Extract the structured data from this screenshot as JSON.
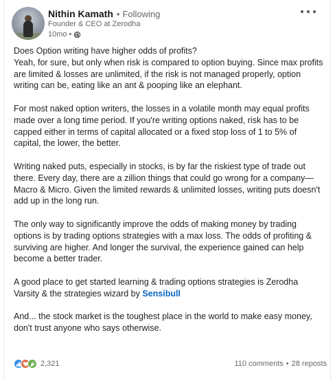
{
  "author": {
    "name": "Nithin Kamath",
    "follow_separator": "•",
    "follow_status": "Following",
    "headline": "Founder & CEO at Zerodha",
    "time": "10mo",
    "time_separator": "•"
  },
  "post": {
    "paragraphs": [
      "Does Option writing have higher odds of profits?\nYeah, for sure, but only when risk is compared to option buying. Since max profits\nare limited & losses are unlimited, if the risk is not managed properly, option\nwriting can be, eating like an ant & pooping like an elephant.",
      "For most naked option writers, the losses in a volatile month may equal profits\nmade over a long time period. If you're writing options naked, risk has to be\ncapped either in terms of capital allocated or a fixed stop loss of 1 to 5% of\ncapital, the lower, the better.",
      "Writing naked puts, especially in stocks, is by far the riskiest type of trade out\nthere. Every day, there are a zillion things that could go wrong for a company—\nMacro & Micro. Given the limited rewards & unlimited losses, writing puts doesn't\nadd up in the long run.",
      "The only way to significantly improve the odds of making money by trading\noptions is by trading options strategies with a max loss. The odds of profiting &\nsurviving are higher. And longer the survival, the experience gained can help\nbecome a better trader."
    ],
    "paragraph5_text": "A good place to get started learning & trading options strategies is Zerodha\nVarsity & the strategies wizard by ",
    "paragraph5_link": "Sensibull",
    "paragraph6": "And... the stock market is the toughest place in the world to make easy money,\ndon't trust anyone who says otherwise."
  },
  "social": {
    "reaction_count": "2,321",
    "comments": "110 comments",
    "stats_separator": "•",
    "reposts": "28 reposts"
  },
  "colors": {
    "link": "#0a66c2",
    "like": "#378fe9",
    "love": "#df704d",
    "celebrate": "#6dae4f"
  }
}
